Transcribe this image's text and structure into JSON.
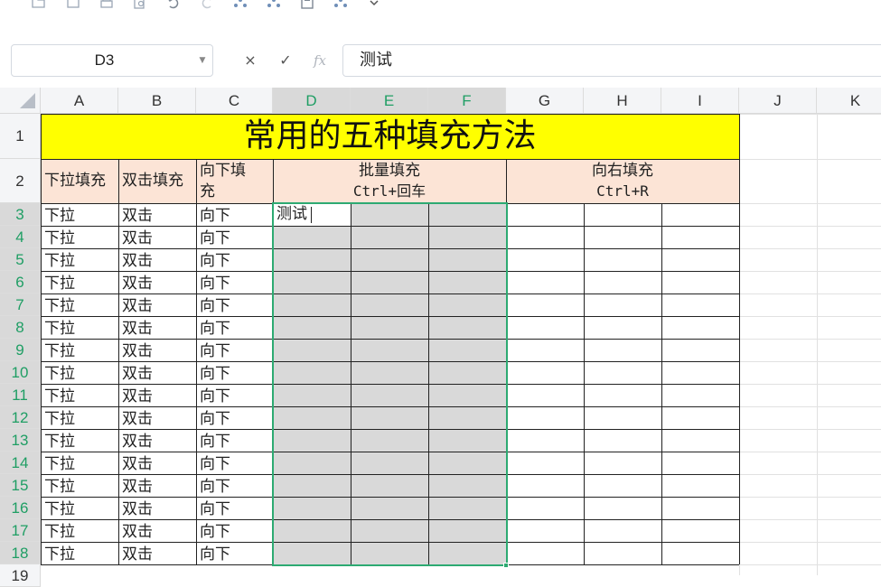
{
  "toolbar": {
    "icons": [
      "open-icon",
      "save-as-icon",
      "print-icon",
      "print-preview-icon",
      "undo-icon",
      "redo-icon",
      "format-painter-icon",
      "format-painter-2-icon",
      "save-icon",
      "share-icon",
      "more-dropdown-icon"
    ]
  },
  "formula_bar": {
    "cell_reference": "D3",
    "cancel_symbol": "×",
    "confirm_symbol": "✓",
    "fx_symbol": "fx",
    "content": "测试"
  },
  "columns": [
    "A",
    "B",
    "C",
    "D",
    "E",
    "F",
    "G",
    "H",
    "I",
    "J",
    "K"
  ],
  "rows": [
    "1",
    "2",
    "3",
    "4",
    "5",
    "6",
    "7",
    "8",
    "9",
    "10",
    "11",
    "12",
    "13",
    "14",
    "15",
    "16",
    "17",
    "18",
    "19"
  ],
  "sheet": {
    "title": "常用的五种填充方法",
    "headers": {
      "a": "下拉填充",
      "b": "双击填充",
      "c_line1": "向下填",
      "c_line2": "充",
      "d_line1": "批量填充",
      "d_line2": "Ctrl+回车",
      "g_line1": "向右填充",
      "g_line2": "Ctrl+R"
    },
    "col_a_values": [
      "下拉",
      "下拉",
      "下拉",
      "下拉",
      "下拉",
      "下拉",
      "下拉",
      "下拉",
      "下拉",
      "下拉",
      "下拉",
      "下拉",
      "下拉",
      "下拉",
      "下拉",
      "下拉"
    ],
    "col_b_values": [
      "双击",
      "双击",
      "双击",
      "双击",
      "双击",
      "双击",
      "双击",
      "双击",
      "双击",
      "双击",
      "双击",
      "双击",
      "双击",
      "双击",
      "双击",
      "双击"
    ],
    "col_c_values": [
      "向下",
      "向下",
      "向下",
      "向下",
      "向下",
      "向下",
      "向下",
      "向下",
      "向下",
      "向下",
      "向下",
      "向下",
      "向下",
      "向下",
      "向下",
      "向下"
    ],
    "active_cell_value": "测试"
  },
  "colors": {
    "title_fill": "#ffff00",
    "header_fill": "#fce4d6",
    "selection_border": "#2daa72",
    "selected_header_text": "#1f9e64",
    "selected_fill": "#d9d9d9"
  }
}
